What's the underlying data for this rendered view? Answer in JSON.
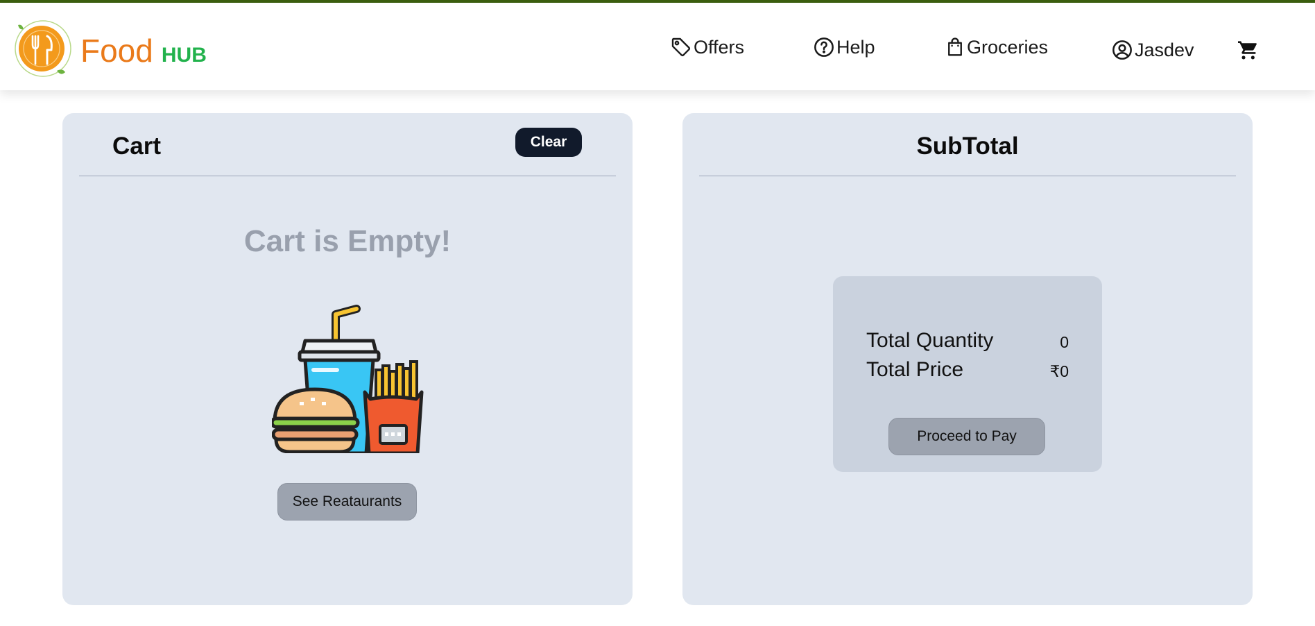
{
  "brand": {
    "name": "Food",
    "suffix": "HUB"
  },
  "nav": {
    "offers": "Offers",
    "help": "Help",
    "groceries": "Groceries",
    "user": "Jasdev"
  },
  "cart": {
    "title": "Cart",
    "clear_label": "Clear",
    "empty_message": "Cart is Empty!",
    "see_restaurants_label": "See Reataurants"
  },
  "subtotal": {
    "title": "SubTotal",
    "total_quantity_label": "Total Quantity",
    "total_quantity_value": "0",
    "total_price_label": "Total Price",
    "total_price_value": "₹0",
    "proceed_label": "Proceed to Pay"
  },
  "icons": [
    "logo-icon",
    "tag-icon",
    "help-icon",
    "shopping-bag-icon",
    "user-circle-icon",
    "cart-icon",
    "fast-food-illustration"
  ],
  "colors": {
    "brand_orange": "#ea7a1a",
    "brand_green": "#22b24c",
    "panel_bg": "#e1e7f0",
    "card_bg": "#cad2de",
    "dark_button": "#111a2b",
    "grey_button": "#9ca3af"
  }
}
